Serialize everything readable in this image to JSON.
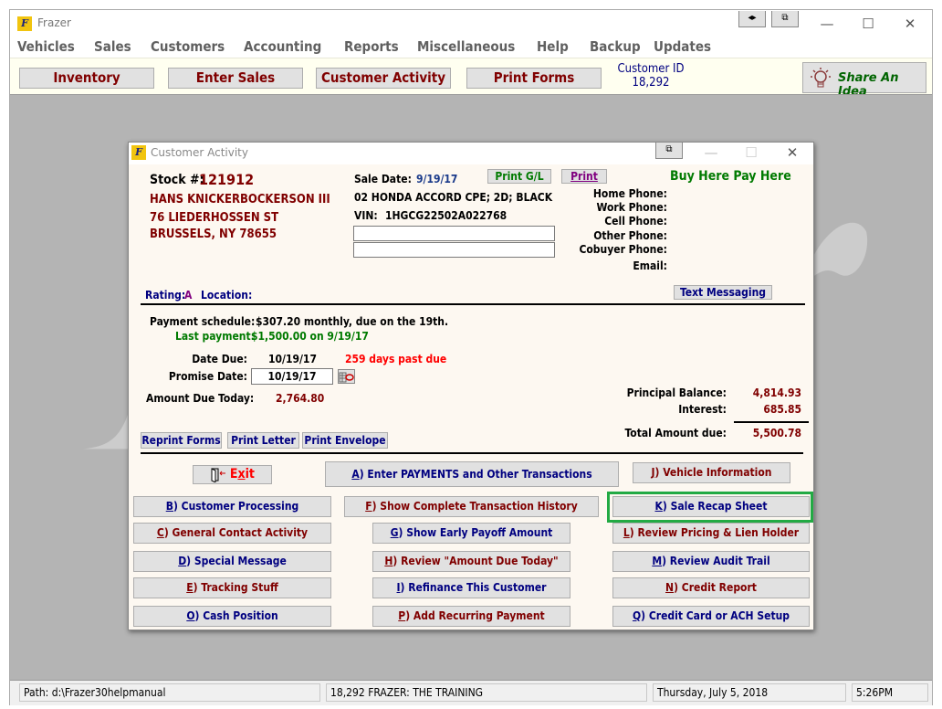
{
  "app": {
    "title": "Frazer",
    "title_buttons": [
      "◂▸",
      "⧉"
    ],
    "window_controls": {
      "minimize": "—",
      "maximize": "☐",
      "close": "✕"
    }
  },
  "menu": [
    "Vehicles",
    "Sales",
    "Customers",
    "Accounting",
    "Reports",
    "Miscellaneous",
    "Help",
    "Backup",
    "Updates"
  ],
  "toolbar": {
    "buttons": [
      "Inventory",
      "Enter Sales",
      "Customer Activity",
      "Print Forms"
    ],
    "customer_id_label": "Customer ID",
    "customer_id_value": "18,292",
    "share_idea": "Share An Idea",
    "share_icon": "lightbulb-icon"
  },
  "dialog": {
    "title": "Customer Activity",
    "restore_glyph": "⧉",
    "controls": {
      "minimize": "—",
      "maximize": "☐",
      "close": "✕"
    },
    "stock_label": "Stock #:",
    "stock_value": "121912",
    "customer_name": "HANS KNICKERBOCKERSON III",
    "address1": "76 LIEDERHOSSEN ST",
    "address2": "BRUSSELS, NY 78655",
    "sale_date_label": "Sale Date:",
    "sale_date_value": "9/19/17",
    "print_gl": "Print G/L",
    "print": "Print",
    "program": "Buy Here Pay Here",
    "vehicle": "02 HONDA ACCORD CPE; 2D; BLACK",
    "vin_label": "VIN:",
    "vin_value": "1HGCG22502A022768",
    "note_field_1": "",
    "note_field_2": "",
    "phones": [
      {
        "label": "Home Phone:",
        "value": ""
      },
      {
        "label": "Work Phone:",
        "value": ""
      },
      {
        "label": "Cell Phone:",
        "value": ""
      },
      {
        "label": "Other Phone:",
        "value": ""
      },
      {
        "label": "Cobuyer Phone:",
        "value": ""
      },
      {
        "label": "Email:",
        "value": ""
      }
    ],
    "rating_label": "Rating:",
    "rating_value": "A",
    "location_label": "Location:",
    "location_value": "",
    "text_messaging": "Text Messaging",
    "payment_schedule_label": "Payment schedule:",
    "payment_schedule_value": "$307.20 monthly, due on the 19th.",
    "last_payment_label": "Last payment:",
    "last_payment_value": "$1,500.00 on  9/19/17",
    "date_due_label": "Date Due:",
    "date_due_value": "10/19/17",
    "past_due": "259 days past due",
    "promise_date_label": "Promise Date:",
    "promise_date_value": "10/19/17",
    "amount_due_today_label": "Amount Due Today:",
    "amount_due_today_value": "2,764.80",
    "principal_label": "Principal Balance:",
    "principal_value": "4,814.93",
    "interest_label": "Interest:",
    "interest_value": "685.85",
    "total_label": "Total Amount due:",
    "total_value": "5,500.78",
    "reprint_forms": "Reprint Forms",
    "print_letter": "Print Letter",
    "print_envelope": "Print Envelope",
    "exit_pre": "E",
    "exit_key": "x",
    "exit_post": "it",
    "actions": {
      "A": {
        "key": "A",
        "label": ") Enter PAYMENTS and Other Transactions"
      },
      "B": {
        "key": "B",
        "label": ") Customer Processing"
      },
      "C": {
        "key": "C",
        "label": ") General Contact Activity"
      },
      "D": {
        "key": "D",
        "label": ") Special Message"
      },
      "E": {
        "key": "E",
        "label": ") Tracking Stuff"
      },
      "O": {
        "key": "O",
        "label": ") Cash Position"
      },
      "F": {
        "key": "F",
        "label": ") Show Complete Transaction History"
      },
      "G": {
        "key": "G",
        "label": ") Show Early Payoff Amount"
      },
      "H": {
        "key": "H",
        "label": ") Review \"Amount Due Today\""
      },
      "I": {
        "key": "I",
        "label": ") Refinance This Customer"
      },
      "P": {
        "key": "P",
        "label": ") Add Recurring Payment"
      },
      "J": {
        "key": "J",
        "label": ") Vehicle Information"
      },
      "K": {
        "key": "K",
        "label": ") Sale Recap Sheet"
      },
      "L": {
        "key": "L",
        "label": ") Review Pricing & Lien Holder"
      },
      "M": {
        "key": "M",
        "label": ") Review Audit Trail"
      },
      "N": {
        "key": "N",
        "label": ") Credit Report"
      },
      "Q": {
        "key": "Q",
        "label": ") Credit Card or ACH Setup"
      }
    },
    "highlighted_action": "K",
    "highlight_color": "#22aa44"
  },
  "statusbar": {
    "path": "Path: d:\\Frazer30helpmanual",
    "dealer": "18,292  FRAZER: THE TRAINING",
    "date": "Thursday, July  5, 2018",
    "time": "5:26PM"
  }
}
